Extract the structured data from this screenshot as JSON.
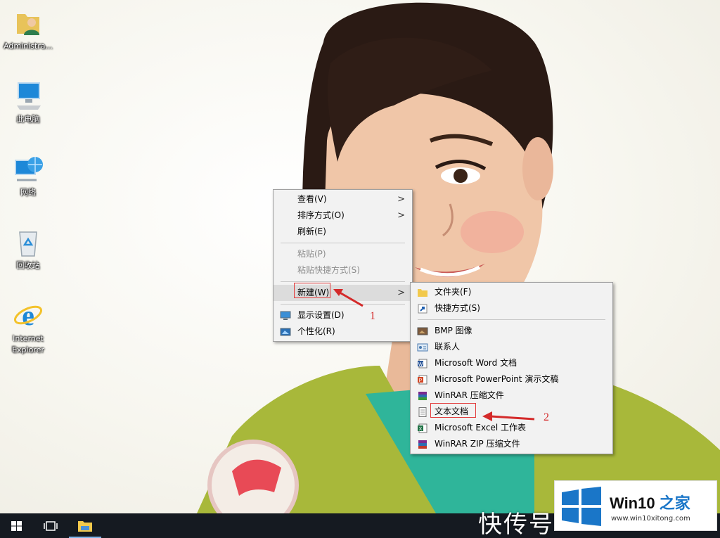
{
  "desktop": {
    "icons": [
      {
        "label": "Administra...",
        "icon": "user-folder-icon"
      },
      {
        "label": "此电脑",
        "icon": "computer-icon"
      },
      {
        "label": "网络",
        "icon": "network-icon"
      },
      {
        "label": "回收站",
        "icon": "recycle-bin-icon"
      },
      {
        "label": "Internet Explorer",
        "icon": "internet-explorer-icon"
      }
    ]
  },
  "context_menu": {
    "items": [
      {
        "label": "查看(V)",
        "submenu": true
      },
      {
        "label": "排序方式(O)",
        "submenu": true
      },
      {
        "label": "刷新(E)"
      },
      {
        "label": "粘贴(P)",
        "disabled": true
      },
      {
        "label": "粘贴快捷方式(S)",
        "disabled": true
      },
      {
        "label": "新建(W)",
        "submenu": true,
        "highlighted": true
      },
      {
        "label": "显示设置(D)",
        "icon": "display-settings-icon"
      },
      {
        "label": "个性化(R)",
        "icon": "personalize-icon"
      }
    ],
    "arrow_glyph": ">"
  },
  "new_submenu": {
    "items": [
      {
        "label": "文件夹(F)",
        "icon": "folder-icon"
      },
      {
        "label": "快捷方式(S)",
        "icon": "shortcut-icon"
      },
      {
        "label": "BMP 图像",
        "icon": "bmp-image-icon"
      },
      {
        "label": "联系人",
        "icon": "contact-icon"
      },
      {
        "label": "Microsoft Word 文档",
        "icon": "word-icon"
      },
      {
        "label": "Microsoft PowerPoint 演示文稿",
        "icon": "powerpoint-icon"
      },
      {
        "label": "WinRAR 压缩文件",
        "icon": "winrar-icon"
      },
      {
        "label": "文本文档",
        "icon": "text-document-icon"
      },
      {
        "label": "Microsoft Excel 工作表",
        "icon": "excel-icon"
      },
      {
        "label": "WinRAR ZIP 压缩文件",
        "icon": "winrar-zip-icon"
      }
    ]
  },
  "annotations": {
    "step1": "1",
    "step2": "2",
    "color": "#d42a2a"
  },
  "taskbar": {
    "buttons": [
      {
        "name": "start",
        "icon": "windows-start-icon"
      },
      {
        "name": "task-view",
        "icon": "task-view-icon"
      },
      {
        "name": "file-explorer",
        "icon": "file-explorer-icon"
      }
    ],
    "background": "#151a21"
  },
  "watermarks": {
    "kuaichuan": "快传号",
    "badge_title_a": "Win10",
    "badge_title_b": " 之家",
    "badge_url": "www.win10xitong.com",
    "badge_accent": "#1a76c8"
  }
}
